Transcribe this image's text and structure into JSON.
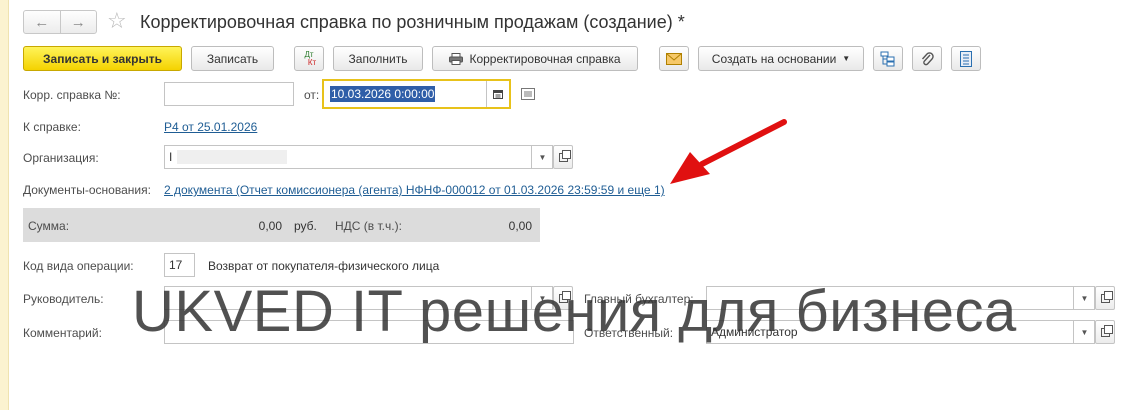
{
  "window": {
    "title": "Корректировочная справка по розничным продажам (создание) *"
  },
  "toolbar": {
    "save_close": "Записать и закрыть",
    "save": "Записать",
    "dtkt_top": "Дт",
    "dtkt_bottom": "Кт",
    "fill": "Заполнить",
    "correction_print": "Корректировочная справка",
    "create_based": "Создать на основании"
  },
  "form": {
    "corr_number_label": "Корр. справка №:",
    "corr_number_value": "",
    "date_label": "от:",
    "date_value": "10.03.2026  0:00:00",
    "to_ref_label": "К справке:",
    "to_ref_value": "Р4 от 25.01.2026",
    "org_label": "Организация:",
    "org_value": "I",
    "base_docs_label": "Документы-основания:",
    "base_docs_value": "2 документа (Отчет комиссионера (агента) НФНФ-000012 от 01.03.2026 23:59:59 и еще 1)",
    "sum_label": "Сумма:",
    "sum_value": "0,00",
    "currency": "руб.",
    "vat_label": "НДС (в т.ч.):",
    "vat_value": "0,00",
    "op_code_label": "Код вида операции:",
    "op_code_value": "17",
    "op_code_desc": "Возврат от покупателя-физического лица",
    "head_label": "Руководитель:",
    "head_value": "",
    "chief_acc_label": "Главный бухгалтер:",
    "chief_acc_value": "",
    "comment_label": "Комментарий:",
    "comment_value": "",
    "responsible_label": "Ответственный:",
    "responsible_value": "Администратор"
  },
  "watermark": "UKVED IT решения для бизнеса",
  "colors": {
    "primary_button": "#f4d200",
    "link": "#1f5d94",
    "arrow": "#e01010",
    "date_focus_border": "#e8c21a"
  }
}
